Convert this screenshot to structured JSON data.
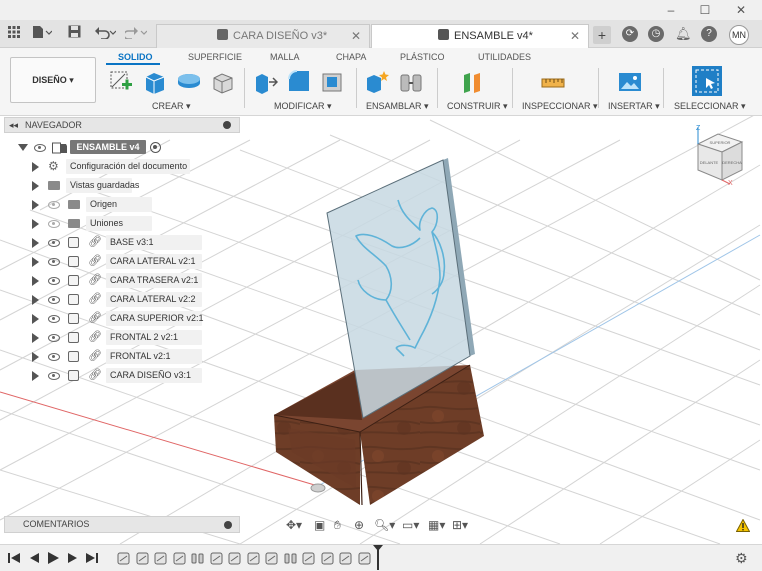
{
  "window": {
    "minimize": "–",
    "maximize": "☐",
    "close": "✕"
  },
  "tabs": [
    {
      "label": "CARA DISEÑO v3*",
      "close": "✕",
      "active": false
    },
    {
      "label": "ENSAMBLE v4*",
      "close": "✕",
      "active": true
    }
  ],
  "user": {
    "initials": "MN"
  },
  "ribbon": {
    "workspace_button": "DISEÑO ▾",
    "tabs": [
      "SOLIDO",
      "SUPERFICIE",
      "MALLA",
      "CHAPA",
      "PLÁSTICO",
      "UTILIDADES"
    ],
    "active_tab": "SOLIDO",
    "groups": [
      "CREAR ▾",
      "MODIFICAR ▾",
      "ENSAMBLAR ▾",
      "CONSTRUIR ▾",
      "INSPECCIONAR ▾",
      "INSERTAR ▾",
      "SELECCIONAR ▾"
    ]
  },
  "browser": {
    "title": "NAVEGADOR",
    "root": "ENSAMBLE v4",
    "items": [
      {
        "label": "Configuración del documento",
        "kind": "settings"
      },
      {
        "label": "Vistas guardadas",
        "kind": "folder"
      },
      {
        "label": "Origen",
        "kind": "folder-hidden"
      },
      {
        "label": "Uniones",
        "kind": "folder-hidden"
      },
      {
        "label": "BASE v3:1",
        "kind": "link"
      },
      {
        "label": "CARA LATERAL v2:1",
        "kind": "link"
      },
      {
        "label": "CARA TRASERA v2:1",
        "kind": "link"
      },
      {
        "label": "CARA LATERAL v2:2",
        "kind": "link"
      },
      {
        "label": "CARA SUPERIOR v2:1",
        "kind": "link"
      },
      {
        "label": "FRONTAL 2 v2:1",
        "kind": "link"
      },
      {
        "label": "FRONTAL v2:1",
        "kind": "link"
      },
      {
        "label": "CARA DISEÑO v3:1",
        "kind": "link"
      }
    ]
  },
  "comments": {
    "title": "COMENTARIOS"
  },
  "viewcube": {
    "top_label": "SUPERIOR",
    "front_label": "DELANTE",
    "right_label": "DERECHA",
    "axis_x": "X",
    "axis_z": "Z"
  },
  "timeline": {
    "item_count": 14
  },
  "colors": {
    "accent": "#0a74c4",
    "wood": "#6b3a26",
    "acrylic": "#a9c7d8",
    "figure_line": "#5fb3d8"
  }
}
